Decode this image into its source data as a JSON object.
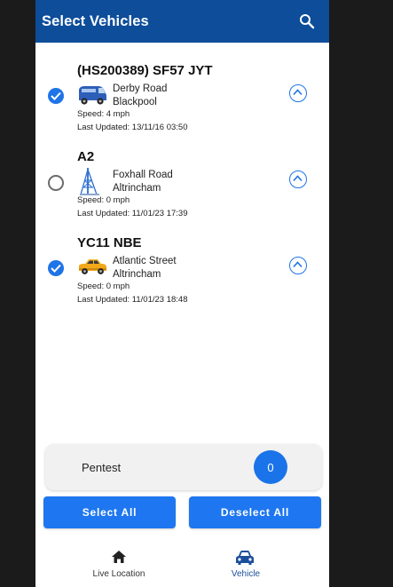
{
  "appbar": {
    "title": "Select Vehicles",
    "search_icon": "search-icon"
  },
  "vehicles": [
    {
      "name": "(HS200389) SF57 JYT",
      "selected": true,
      "icon": "van-icon",
      "address_line1": "Derby Road",
      "address_line2": "Blackpool",
      "speed": "Speed: 4 mph",
      "last_updated": "Last Updated: 13/11/16 03:50"
    },
    {
      "name": "A2",
      "selected": false,
      "icon": "mast-tower-icon",
      "address_line1": "Foxhall Road",
      "address_line2": "Altrincham",
      "speed": "Speed: 0 mph",
      "last_updated": "Last Updated: 11/01/23 17:39"
    },
    {
      "name": "YC11 NBE",
      "selected": true,
      "icon": "car-icon",
      "address_line1": "Atlantic Street",
      "address_line2": "Altrincham",
      "speed": "Speed: 0 mph",
      "last_updated": "Last Updated: 11/01/23 18:48"
    }
  ],
  "group": {
    "name": "Pentest",
    "count": "0"
  },
  "buttons": {
    "select_all": "Select All",
    "deselect_all": "Deselect All"
  },
  "bottom_nav": [
    {
      "label": "Live Location",
      "icon": "home-icon",
      "active": false
    },
    {
      "label": "Vehicle",
      "icon": "car-icon",
      "active": true
    }
  ],
  "colors": {
    "appbar": "#0d4d9a",
    "accent": "#1e77f0",
    "active_nav": "#1c4f9a"
  }
}
